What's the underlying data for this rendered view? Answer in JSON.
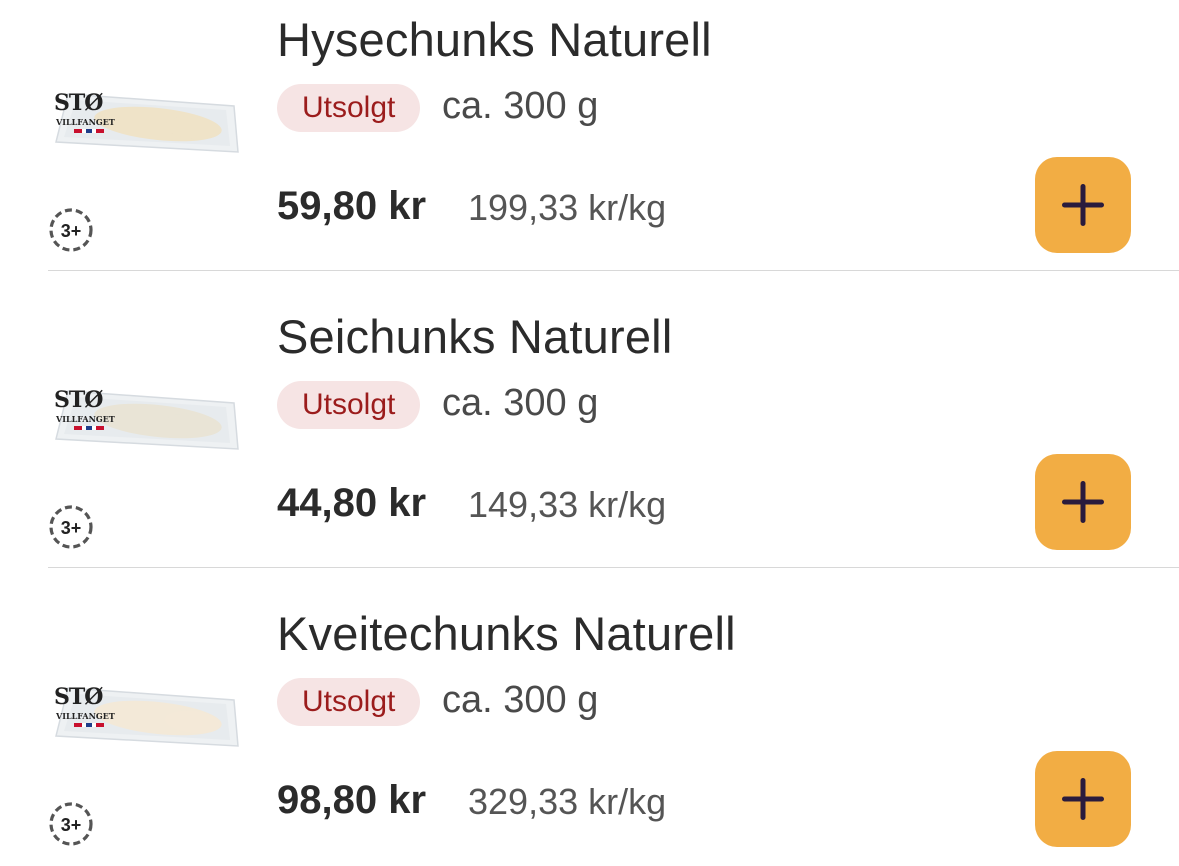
{
  "colors": {
    "status_bg": "#f6e4e4",
    "status_text": "#9b1c1c",
    "add_button": "#f2ad44",
    "add_icon": "#2a1b3d"
  },
  "products": [
    {
      "name": "Hysechunks Naturell",
      "status": "Utsolgt",
      "weight": "ca. 300 g",
      "price": "59,80 kr",
      "unit_price": "199,33 kr/kg",
      "age_badge": "3+",
      "brand_logo": "STØ",
      "brand_sub": "VILLFANGET",
      "fish_color": "#efe3c8"
    },
    {
      "name": "Seichunks Naturell",
      "status": "Utsolgt",
      "weight": "ca. 300 g",
      "price": "44,80 kr",
      "unit_price": "149,33 kr/kg",
      "age_badge": "3+",
      "brand_logo": "STØ",
      "brand_sub": "VILLFANGET",
      "fish_color": "#e9e4d6"
    },
    {
      "name": "Kveitechunks Naturell",
      "status": "Utsolgt",
      "weight": "ca. 300 g",
      "price": "98,80 kr",
      "unit_price": "329,33 kr/kg",
      "age_badge": "3+",
      "brand_logo": "STØ",
      "brand_sub": "VILLFANGET",
      "fish_color": "#f3e9d8"
    }
  ]
}
